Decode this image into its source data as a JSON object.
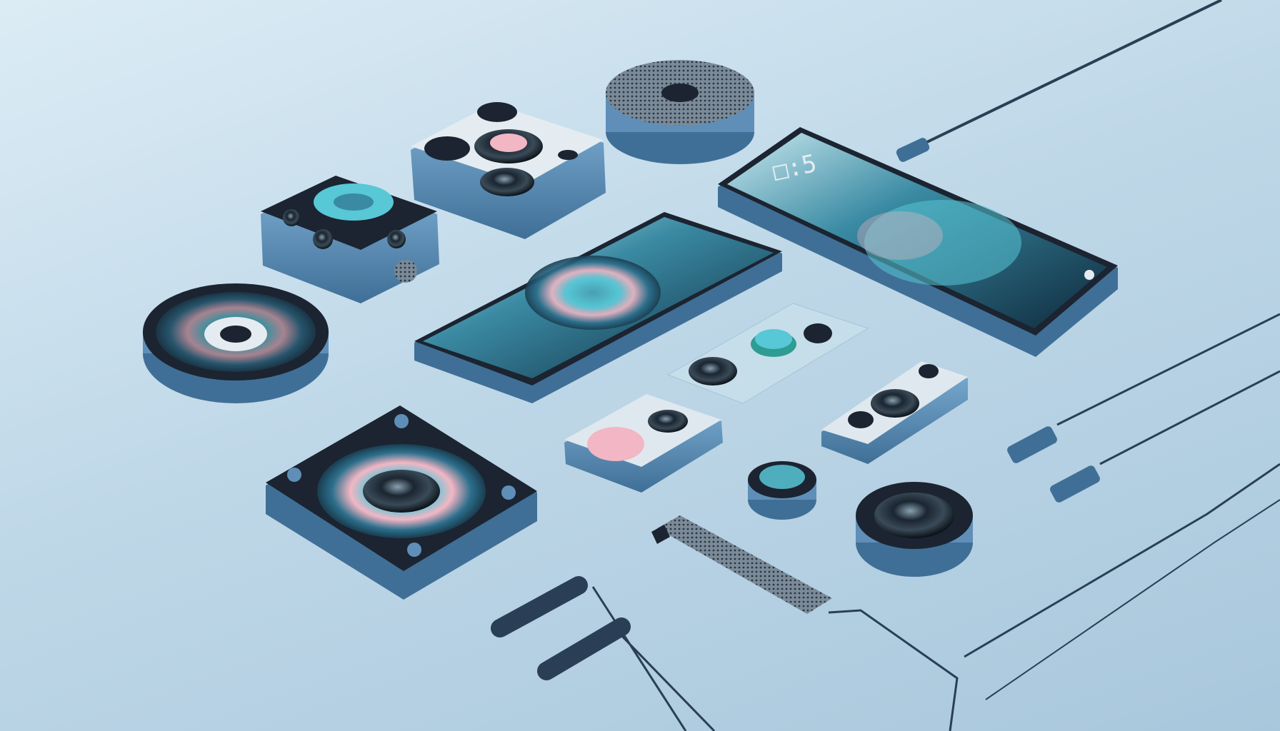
{
  "scene": {
    "description_free": true,
    "phone_right": {
      "clock": "□:5"
    },
    "colors": {
      "background_top": "#dcecf5",
      "background_bottom": "#a9c7dc",
      "device_shell": "#5f8fb8",
      "device_dark": "#1b2430",
      "screen_teal": "#58c7d6",
      "accent_pink": "#f3b6c4",
      "cable": "#2a3f55"
    },
    "icons": [
      "smartphone-icon",
      "camera-lens-icon",
      "speaker-icon",
      "usb-plug-icon",
      "earbud-icon"
    ]
  }
}
